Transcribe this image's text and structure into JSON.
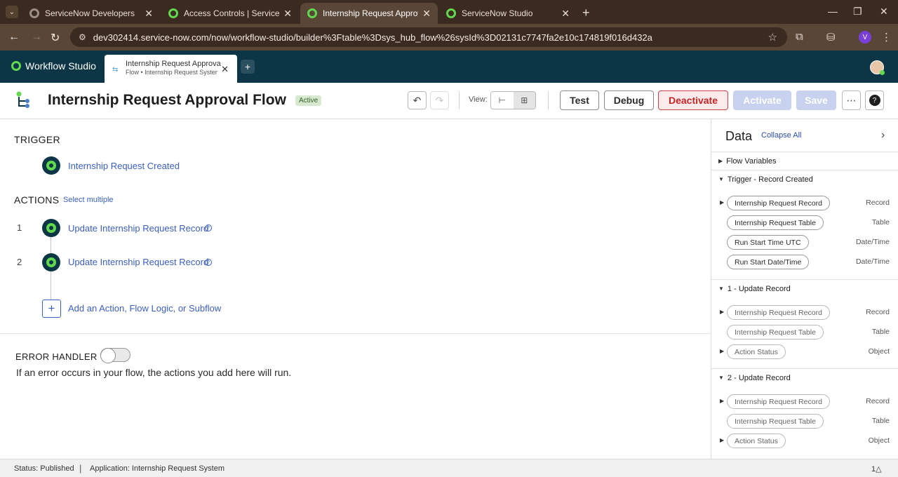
{
  "browser": {
    "tabs": [
      {
        "title": "ServiceNow Developers",
        "active": false
      },
      {
        "title": "Access Controls | ServiceNow",
        "active": false
      },
      {
        "title": "Internship Request Approval Fl",
        "active": true
      },
      {
        "title": "ServiceNow Studio",
        "active": false
      }
    ],
    "url": "dev302414.service-now.com/now/workflow-studio/builder%3Ftable%3Dsys_hub_flow%26sysId%3D02131c7747fa2e10c174819f016d432a",
    "profile_initial": "V"
  },
  "app": {
    "brand": "Workflow Studio",
    "open_tab": {
      "title": "Internship Request Approva",
      "subtitle": "Flow • Internship Request Syster"
    }
  },
  "flow": {
    "title": "Internship Request Approval Flow",
    "status_badge": "Active",
    "view_label": "View:",
    "buttons": {
      "test": "Test",
      "debug": "Debug",
      "deactivate": "Deactivate",
      "activate": "Activate",
      "save": "Save"
    }
  },
  "canvas": {
    "trigger_heading": "TRIGGER",
    "trigger_name": "Internship Request Created",
    "actions_heading": "ACTIONS",
    "select_multiple": "Select multiple",
    "actions": [
      {
        "num": "1",
        "label": "Update Internship Request Record"
      },
      {
        "num": "2",
        "label": "Update Internship Request Record"
      }
    ],
    "add_action": "Add an Action, Flow Logic, or Subflow",
    "error_handler_heading": "ERROR HANDLER",
    "error_handler_enabled": false,
    "error_handler_desc": "If an error occurs in your flow, the actions you add here will run."
  },
  "data_panel": {
    "title": "Data",
    "collapse_all": "Collapse All",
    "flow_variables": "Flow Variables",
    "groups": [
      {
        "title": "Trigger - Record Created",
        "items": [
          {
            "label": "Internship Request Record",
            "type": "Record",
            "expandable": true
          },
          {
            "label": "Internship Request Table",
            "type": "Table",
            "expandable": false
          },
          {
            "label": "Run Start Time UTC",
            "type": "Date/Time",
            "expandable": false
          },
          {
            "label": "Run Start Date/Time",
            "type": "Date/Time",
            "expandable": false
          }
        ]
      },
      {
        "title": "1 - Update Record",
        "items": [
          {
            "label": "Internship Request Record",
            "type": "Record",
            "expandable": true
          },
          {
            "label": "Internship Request Table",
            "type": "Table",
            "expandable": false
          },
          {
            "label": "Action Status",
            "type": "Object",
            "expandable": true
          }
        ]
      },
      {
        "title": "2 - Update Record",
        "items": [
          {
            "label": "Internship Request Record",
            "type": "Record",
            "expandable": true
          },
          {
            "label": "Internship Request Table",
            "type": "Table",
            "expandable": false
          },
          {
            "label": "Action Status",
            "type": "Object",
            "expandable": true
          }
        ]
      }
    ]
  },
  "statusbar": {
    "status": "Status: Published",
    "separator": "|",
    "application": "Application: Internship Request System",
    "notifications": "1△"
  },
  "colors": {
    "header_bg": "#0c3645",
    "accent_green": "#62d84e",
    "link_blue": "#3b5fc0",
    "danger_red": "#c42626"
  }
}
